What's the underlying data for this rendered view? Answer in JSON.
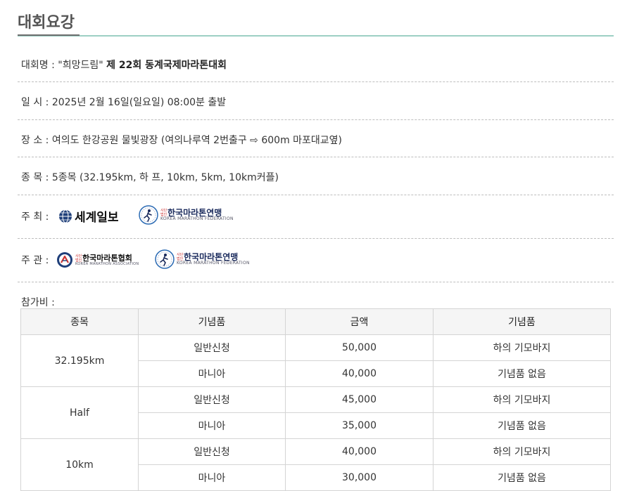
{
  "page_title": "대회요강",
  "info": {
    "name_label": "대회명 : ",
    "name_quote": "\"희망드림\"",
    "name_bold": "제 22회 동계국제마라톤대회",
    "date": "일 시 : 2025년 2월 16일(일요일) 08:00분 출발",
    "place": "장 소 : 여의도 한강공원 물빛광장 (여의나루역 2번출구 ⇨ 600m 마포대교옆)",
    "events": "종 목 : 5종목 (32.195km, 하 프, 10km, 5km, 10km커플)",
    "host_label": "주 최 :",
    "organizer_label": "주 관 :"
  },
  "logos": {
    "segye": "세계일보",
    "kmf_prefix": "사단 법인",
    "kmf_name": "한국마라톤연맹",
    "kmf_sub": "KOREA MARATHON FEDERATION",
    "kma_prefix": "사단 법인",
    "kma_name": "한국마라톤협회",
    "kma_sub": "KOREA MARATHON ASSOCIATION"
  },
  "fee": {
    "label": "참가비 :",
    "headers": [
      "종목",
      "기념품",
      "금액",
      "기념품"
    ],
    "groups": [
      {
        "event": "32.195km",
        "rows": [
          {
            "type": "일반신청",
            "amount": "50,000",
            "gift": "하의 기모바지"
          },
          {
            "type": "마니아",
            "amount": "40,000",
            "gift": "기념품 없음"
          }
        ]
      },
      {
        "event": "Half",
        "rows": [
          {
            "type": "일반신청",
            "amount": "45,000",
            "gift": "하의 기모바지"
          },
          {
            "type": "마니아",
            "amount": "35,000",
            "gift": "기념품 없음"
          }
        ]
      },
      {
        "event": "10km",
        "rows": [
          {
            "type": "일반신청",
            "amount": "40,000",
            "gift": "하의 기모바지"
          },
          {
            "type": "마니아",
            "amount": "30,000",
            "gift": "기념품 없음"
          }
        ]
      }
    ]
  }
}
